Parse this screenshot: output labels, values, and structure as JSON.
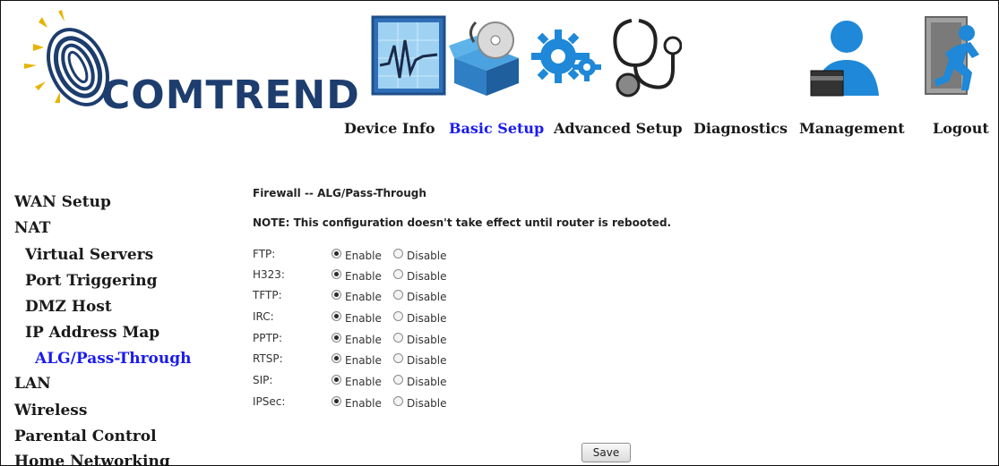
{
  "brand": {
    "name": "COMTREND",
    "colors": {
      "logo_text": "#1d3d6e",
      "accent_blue": "#1a1aee",
      "icon_blue": "#2f8fd6"
    }
  },
  "top_nav": [
    {
      "label": "Device Info",
      "icon": "chart-monitor-icon",
      "active": false
    },
    {
      "label": "Basic Setup",
      "icon": "open-box-disc-icon",
      "active": true
    },
    {
      "label": "Advanced Setup",
      "icon": "gears-icon",
      "active": false
    },
    {
      "label": "Diagnostics",
      "icon": "stethoscope-icon",
      "active": false
    },
    {
      "label": "Management",
      "icon": "user-card-icon",
      "active": false
    },
    {
      "label": "Logout",
      "icon": "exit-door-icon",
      "active": false
    }
  ],
  "sidebar": {
    "items": [
      {
        "label": "WAN Setup",
        "level": 0,
        "active": false
      },
      {
        "label": "NAT",
        "level": 0,
        "active": false
      },
      {
        "label": "Virtual Servers",
        "level": 1,
        "active": false
      },
      {
        "label": "Port Triggering",
        "level": 1,
        "active": false
      },
      {
        "label": "DMZ Host",
        "level": 1,
        "active": false
      },
      {
        "label": "IP Address Map",
        "level": 1,
        "active": false
      },
      {
        "label": "ALG/Pass-Through",
        "level": 1,
        "active": true
      },
      {
        "label": "LAN",
        "level": 0,
        "active": false
      },
      {
        "label": "Wireless",
        "level": 0,
        "active": false
      },
      {
        "label": "Parental Control",
        "level": 0,
        "active": false
      },
      {
        "label": "Home Networking",
        "level": 0,
        "active": false
      }
    ]
  },
  "main": {
    "title": "Firewall -- ALG/Pass-Through",
    "note": "NOTE: This configuration doesn't take effect until router is rebooted.",
    "enable_label": "Enable",
    "disable_label": "Disable",
    "protocols": [
      {
        "name": "FTP:",
        "selected": "Enable"
      },
      {
        "name": "H323:",
        "selected": "Enable"
      },
      {
        "name": "TFTP:",
        "selected": "Enable"
      },
      {
        "name": "IRC:",
        "selected": "Enable"
      },
      {
        "name": "PPTP:",
        "selected": "Enable"
      },
      {
        "name": "RTSP:",
        "selected": "Enable"
      },
      {
        "name": "SIP:",
        "selected": "Enable"
      },
      {
        "name": "IPSec:",
        "selected": "Enable"
      }
    ],
    "save_label": "Save"
  }
}
